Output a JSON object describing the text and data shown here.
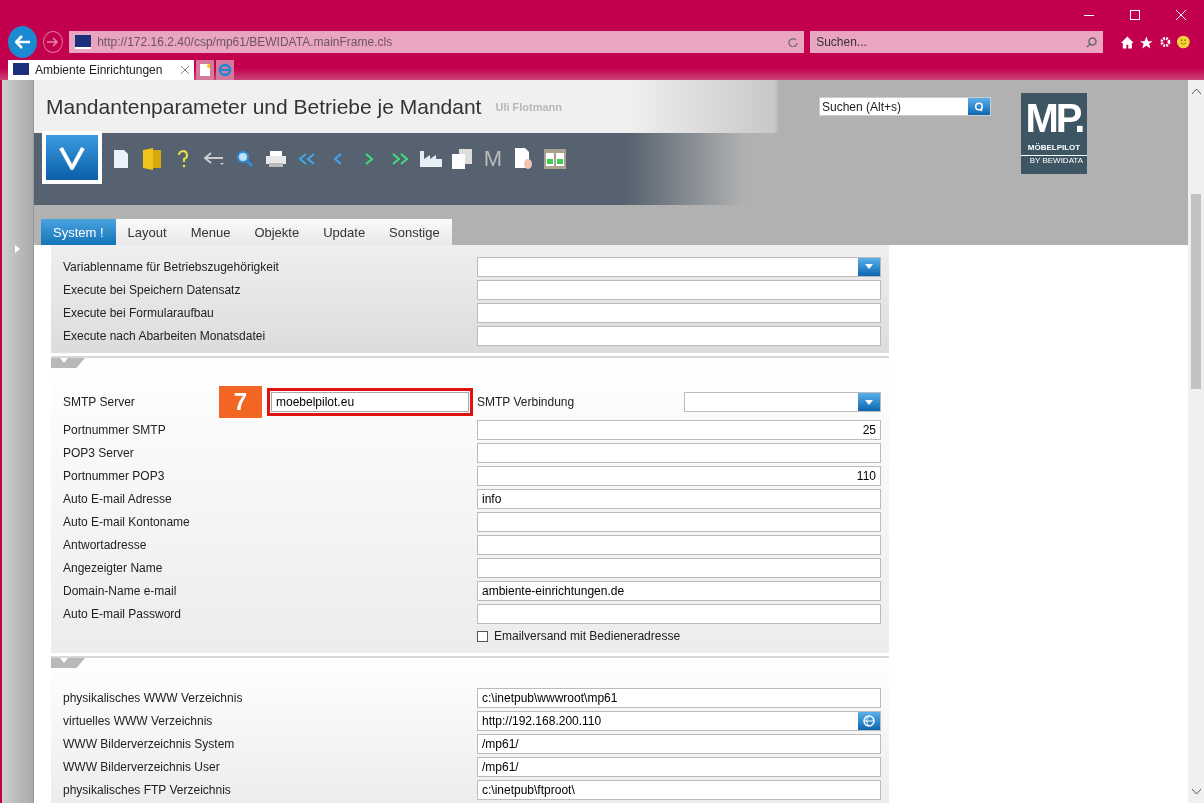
{
  "browser": {
    "address": "http://172.16.2.40/csp/mp61/BEWIDATA.mainFrame.cls",
    "search_placeholder": "Suchen...",
    "tab": {
      "title": "Ambiente Einrichtungen"
    }
  },
  "header": {
    "title": "Mandantenparameter und Betriebe je Mandant",
    "user": "Uli Flotmann",
    "search_placeholder": "Suchen (Alt+s)",
    "toolbar_letter": "M",
    "logo": {
      "mark": "MP.",
      "name": "MÖBELPILOT",
      "by": "BY BEWIDATA"
    }
  },
  "tabs": [
    {
      "label": "System !",
      "selected": true
    },
    {
      "label": "Layout",
      "selected": false
    },
    {
      "label": "Menue",
      "selected": false
    },
    {
      "label": "Objekte",
      "selected": false
    },
    {
      "label": "Update",
      "selected": false
    },
    {
      "label": "Sonstige",
      "selected": false
    }
  ],
  "sections": [
    {
      "rows": [
        {
          "kind": "select",
          "label": "Variablenname für Betriebszugehörigkeit"
        },
        {
          "kind": "text",
          "label": "Execute bei Speichern Datensatz"
        },
        {
          "kind": "text",
          "label": "Execute bei Formularaufbau"
        },
        {
          "kind": "text",
          "label": "Execute nach Abarbeiten Monatsdatei"
        }
      ]
    },
    {
      "rows": [
        {
          "kind": "pair",
          "label": "SMTP Server",
          "value": "moebelpilot.eu",
          "callout": "7",
          "label2": "SMTP Verbindung"
        },
        {
          "kind": "number",
          "label": "Portnummer SMTP",
          "value": "25"
        },
        {
          "kind": "text",
          "label": "POP3 Server"
        },
        {
          "kind": "number",
          "label": "Portnummer POP3",
          "value": "110"
        },
        {
          "kind": "text",
          "label": "Auto E-mail Adresse",
          "value": "info"
        },
        {
          "kind": "text",
          "label": "Auto E-mail Kontoname"
        },
        {
          "kind": "text",
          "label": "Antwortadresse"
        },
        {
          "kind": "text",
          "label": "Angezeigter Name"
        },
        {
          "kind": "text",
          "label": "Domain-Name e-mail",
          "value": "ambiente-einrichtungen.de"
        },
        {
          "kind": "text",
          "label": "Auto E-mail Password"
        },
        {
          "kind": "checkbox",
          "label": "Emailversand mit Bedieneradresse",
          "checked": false
        }
      ]
    },
    {
      "rows": [
        {
          "kind": "text",
          "label": "physikalisches WWW Verzeichnis",
          "value": "c:\\inetpub\\wwwroot\\mp61"
        },
        {
          "kind": "globe",
          "label": "virtuelles WWW Verzeichnis",
          "value": "http://192.168.200.110"
        },
        {
          "kind": "text",
          "label": "WWW Bilderverzeichnis System",
          "value": "/mp61/"
        },
        {
          "kind": "text",
          "label": "WWW Bilderverzeichnis User",
          "value": "/mp61/"
        },
        {
          "kind": "text",
          "label": "physikalisches FTP Verzeichnis",
          "value": "c:\\inetpub\\ftproot\\"
        }
      ]
    }
  ]
}
